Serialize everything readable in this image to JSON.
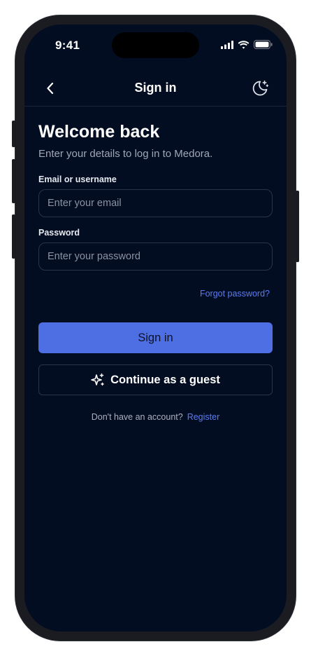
{
  "status_bar": {
    "time": "9:41",
    "icons": [
      "cellular-signal-icon",
      "wifi-icon",
      "battery-icon"
    ]
  },
  "nav": {
    "title": "Sign in",
    "back_icon": "chevron-left-icon",
    "theme_icon": "moon-sparkle-icon"
  },
  "form": {
    "heading": "Welcome back",
    "subtitle": "Enter your details to log in to Medora.",
    "email_label": "Email or username",
    "email_placeholder": "Enter your email",
    "email_value": "",
    "password_label": "Password",
    "password_placeholder": "Enter your password",
    "password_value": "",
    "forgot_label": "Forgot password?",
    "signin_label": "Sign in",
    "guest_label": "Continue as a guest",
    "guest_icon": "sparkles-icon",
    "no_account_text": "Don't have an account?",
    "register_label": "Register"
  },
  "colors": {
    "background": "#030d21",
    "accent": "#4e6fe4",
    "link": "#5b7cf0",
    "border": "#2b3446",
    "muted_text": "#9ea8b8"
  }
}
